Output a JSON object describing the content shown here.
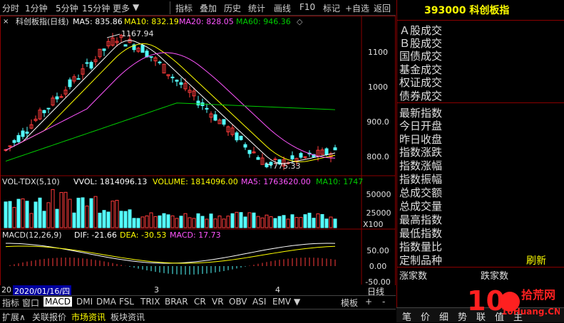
{
  "toolbar": {
    "items": [
      "分时",
      "1分钟",
      "5分钟",
      "15分钟",
      "更多",
      "指标",
      "叠加",
      "历史",
      "统计",
      "画线",
      "F10",
      "标记",
      "+自选",
      "返回"
    ]
  },
  "main": {
    "index_label": "科创板指(日线)",
    "ma5": "MA5: 835.86",
    "ma10": "MA10: 832.19",
    "ma20": "MA20: 828.05",
    "ma60": "MA60: 946.36",
    "y_ticks": [
      "1100",
      "1000",
      "900.0",
      "800.0"
    ],
    "high_label": "1167.94",
    "low_label": "775.33"
  },
  "volume": {
    "label": "VOL-TDX(5,10)",
    "vvol": "VVOL: 1814096.13",
    "volume": "VOLUME: 1814096.00",
    "ma5": "MA5: 1763620.00",
    "ma10": "MA10: 1747",
    "y_ticks": [
      "50000",
      "25000"
    ],
    "unit": "X100"
  },
  "macd": {
    "label": "MACD(12,26,9)",
    "dif": "DIF: -21.66",
    "dea": "DEA: -30.53",
    "macd": "MACD: 17.73",
    "y_ticks": [
      "50.00",
      "0.00",
      "-50.00"
    ]
  },
  "dates": {
    "cursor": "2020/01/16/四",
    "prefix": "20",
    "m3": "3",
    "m4": "4",
    "period": "日线"
  },
  "indicators": [
    "指标",
    "窗口",
    "MACD",
    "DMI",
    "DMA",
    "FSL",
    "TRIX",
    "BRAR",
    "CR",
    "VR",
    "OBV",
    "ASI",
    "EMV",
    "模板"
  ],
  "footer": [
    "扩展∧",
    "关联报价",
    "市场资讯",
    "板块资讯"
  ],
  "right_panel": {
    "title": "393000 科创板指",
    "items_a": [
      "Ａ股成交",
      "Ｂ股成交",
      "国债成交",
      "基金成交",
      "权证成交",
      "债券成交"
    ],
    "items_b": [
      "最新指数",
      "今日开盘",
      "昨日收盘",
      "指数涨跌",
      "指数涨幅",
      "指数振幅",
      "总成交额",
      "总成交量",
      "最高指数",
      "最低指数",
      "指数量比",
      "定制品种"
    ],
    "refresh": "刷新",
    "up_count": "涨家数",
    "down_count": "跌家数",
    "tabs": [
      "笔",
      "价",
      "细",
      "势",
      "联",
      "值",
      "主"
    ]
  },
  "logo": {
    "text": "拾荒网",
    "sub": "10Huang.CN"
  },
  "colors": {
    "up": "#ff3b3b",
    "down": "#54ffff",
    "ma5": "#ffffff",
    "ma10": "#ffff00",
    "ma20": "#ff55ff",
    "ma60": "#00cc00",
    "frame": "#8b0000"
  },
  "chart_data": [
    {
      "type": "candlestick",
      "series": [
        {
          "name": "MA5",
          "value": 835.86
        },
        {
          "name": "MA10",
          "value": 832.19
        },
        {
          "name": "MA20",
          "value": 828.05
        },
        {
          "name": "MA60",
          "value": 946.36
        }
      ],
      "high": 1167.94,
      "low": 775.33,
      "ylim": [
        760,
        1200
      ]
    },
    {
      "type": "bar",
      "series": [
        {
          "name": "VOLUME",
          "value": 1814096
        },
        {
          "name": "MA5",
          "value": 1763620
        }
      ]
    },
    {
      "type": "bar",
      "series": [
        {
          "name": "DIF",
          "value": -21.66
        },
        {
          "name": "DEA",
          "value": -30.53
        },
        {
          "name": "MACD",
          "value": 17.73
        }
      ]
    }
  ]
}
